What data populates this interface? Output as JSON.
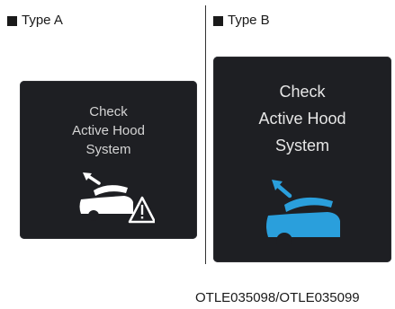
{
  "panels": {
    "type_a": {
      "label": "Type A",
      "message": "Check\nActive Hood\nSystem",
      "icon": "active-hood-warning-icon",
      "icon_color": "#ffffff",
      "screen_color": "#1e1f23"
    },
    "type_b": {
      "label": "Type B",
      "message": "Check\nActive Hood\nSystem",
      "icon": "active-hood-icon",
      "icon_color": "#2a9fdc",
      "screen_color": "#1e1f23"
    }
  },
  "caption": "OTLE035098/OTLE035099"
}
